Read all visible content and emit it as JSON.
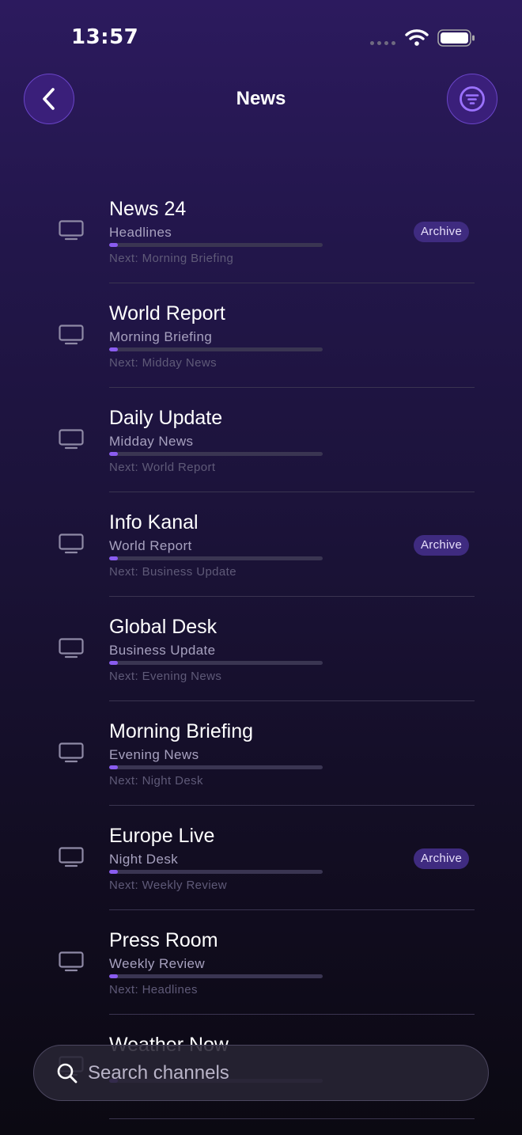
{
  "status_bar": {
    "time": "13:57"
  },
  "header": {
    "title": "News",
    "back_icon": "chevron-left-icon",
    "filter_icon": "filter-icon"
  },
  "theme": {
    "accent": "#8a5cf0",
    "badge_bg": "#3f2b80"
  },
  "channels": [
    {
      "name": "News 24",
      "now": "Headlines",
      "next": "Next: Morning Briefing",
      "badge": "Archive",
      "progress": 0.04
    },
    {
      "name": "World Report",
      "now": "Morning Briefing",
      "next": "Next: Midday News",
      "badge": "",
      "progress": 0.04
    },
    {
      "name": "Daily Update",
      "now": "Midday News",
      "next": "Next: World Report",
      "badge": "",
      "progress": 0.04
    },
    {
      "name": "Info Kanal",
      "now": "World Report",
      "next": "Next: Business Update",
      "badge": "Archive",
      "progress": 0.04
    },
    {
      "name": "Global Desk",
      "now": "Business Update",
      "next": "Next: Evening News",
      "badge": "",
      "progress": 0.04
    },
    {
      "name": "Morning Briefing",
      "now": "Evening News",
      "next": "Next: Night Desk",
      "badge": "",
      "progress": 0.04
    },
    {
      "name": "Europe Live",
      "now": "Night Desk",
      "next": "Next: Weekly Review",
      "badge": "Archive",
      "progress": 0.04
    },
    {
      "name": "Press Room",
      "now": "Weekly Review",
      "next": "Next: Headlines",
      "badge": "",
      "progress": 0.04
    },
    {
      "name": "Weather Now",
      "now": "",
      "next": "",
      "badge": "",
      "progress": 0.04
    }
  ],
  "search": {
    "placeholder": "Search channels",
    "value": "",
    "icon": "search-icon"
  }
}
